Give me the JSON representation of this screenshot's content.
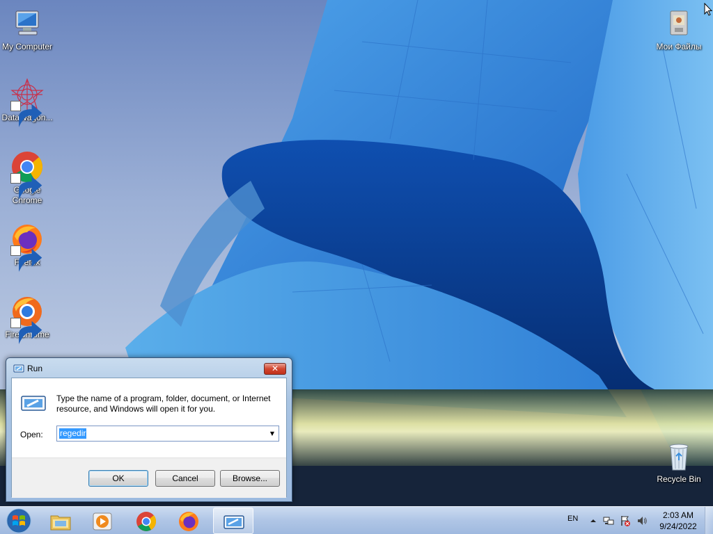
{
  "desktop": {
    "icons": [
      {
        "label": "My Computer"
      },
      {
        "label": "DataWagon..."
      },
      {
        "label": "Google Chrome"
      },
      {
        "label": "Firefox"
      },
      {
        "label": "FireChrome"
      },
      {
        "label": "Мои Файлы"
      },
      {
        "label": "Recycle Bin"
      }
    ]
  },
  "run_dialog": {
    "title": "Run",
    "close_glyph": "✕",
    "description": "Type the name of a program, folder, document, or Internet resource, and Windows will open it for you.",
    "open_label": "Open:",
    "open_value": "regedir",
    "buttons": {
      "ok": "OK",
      "cancel": "Cancel",
      "browse": "Browse..."
    }
  },
  "taskbar": {
    "pinned": [
      "windows-explorer-icon",
      "media-player-icon",
      "chrome-icon",
      "firefox-icon",
      "run-icon"
    ],
    "language": "EN",
    "clock": {
      "time": "2:03 AM",
      "date": "9/24/2022"
    }
  }
}
